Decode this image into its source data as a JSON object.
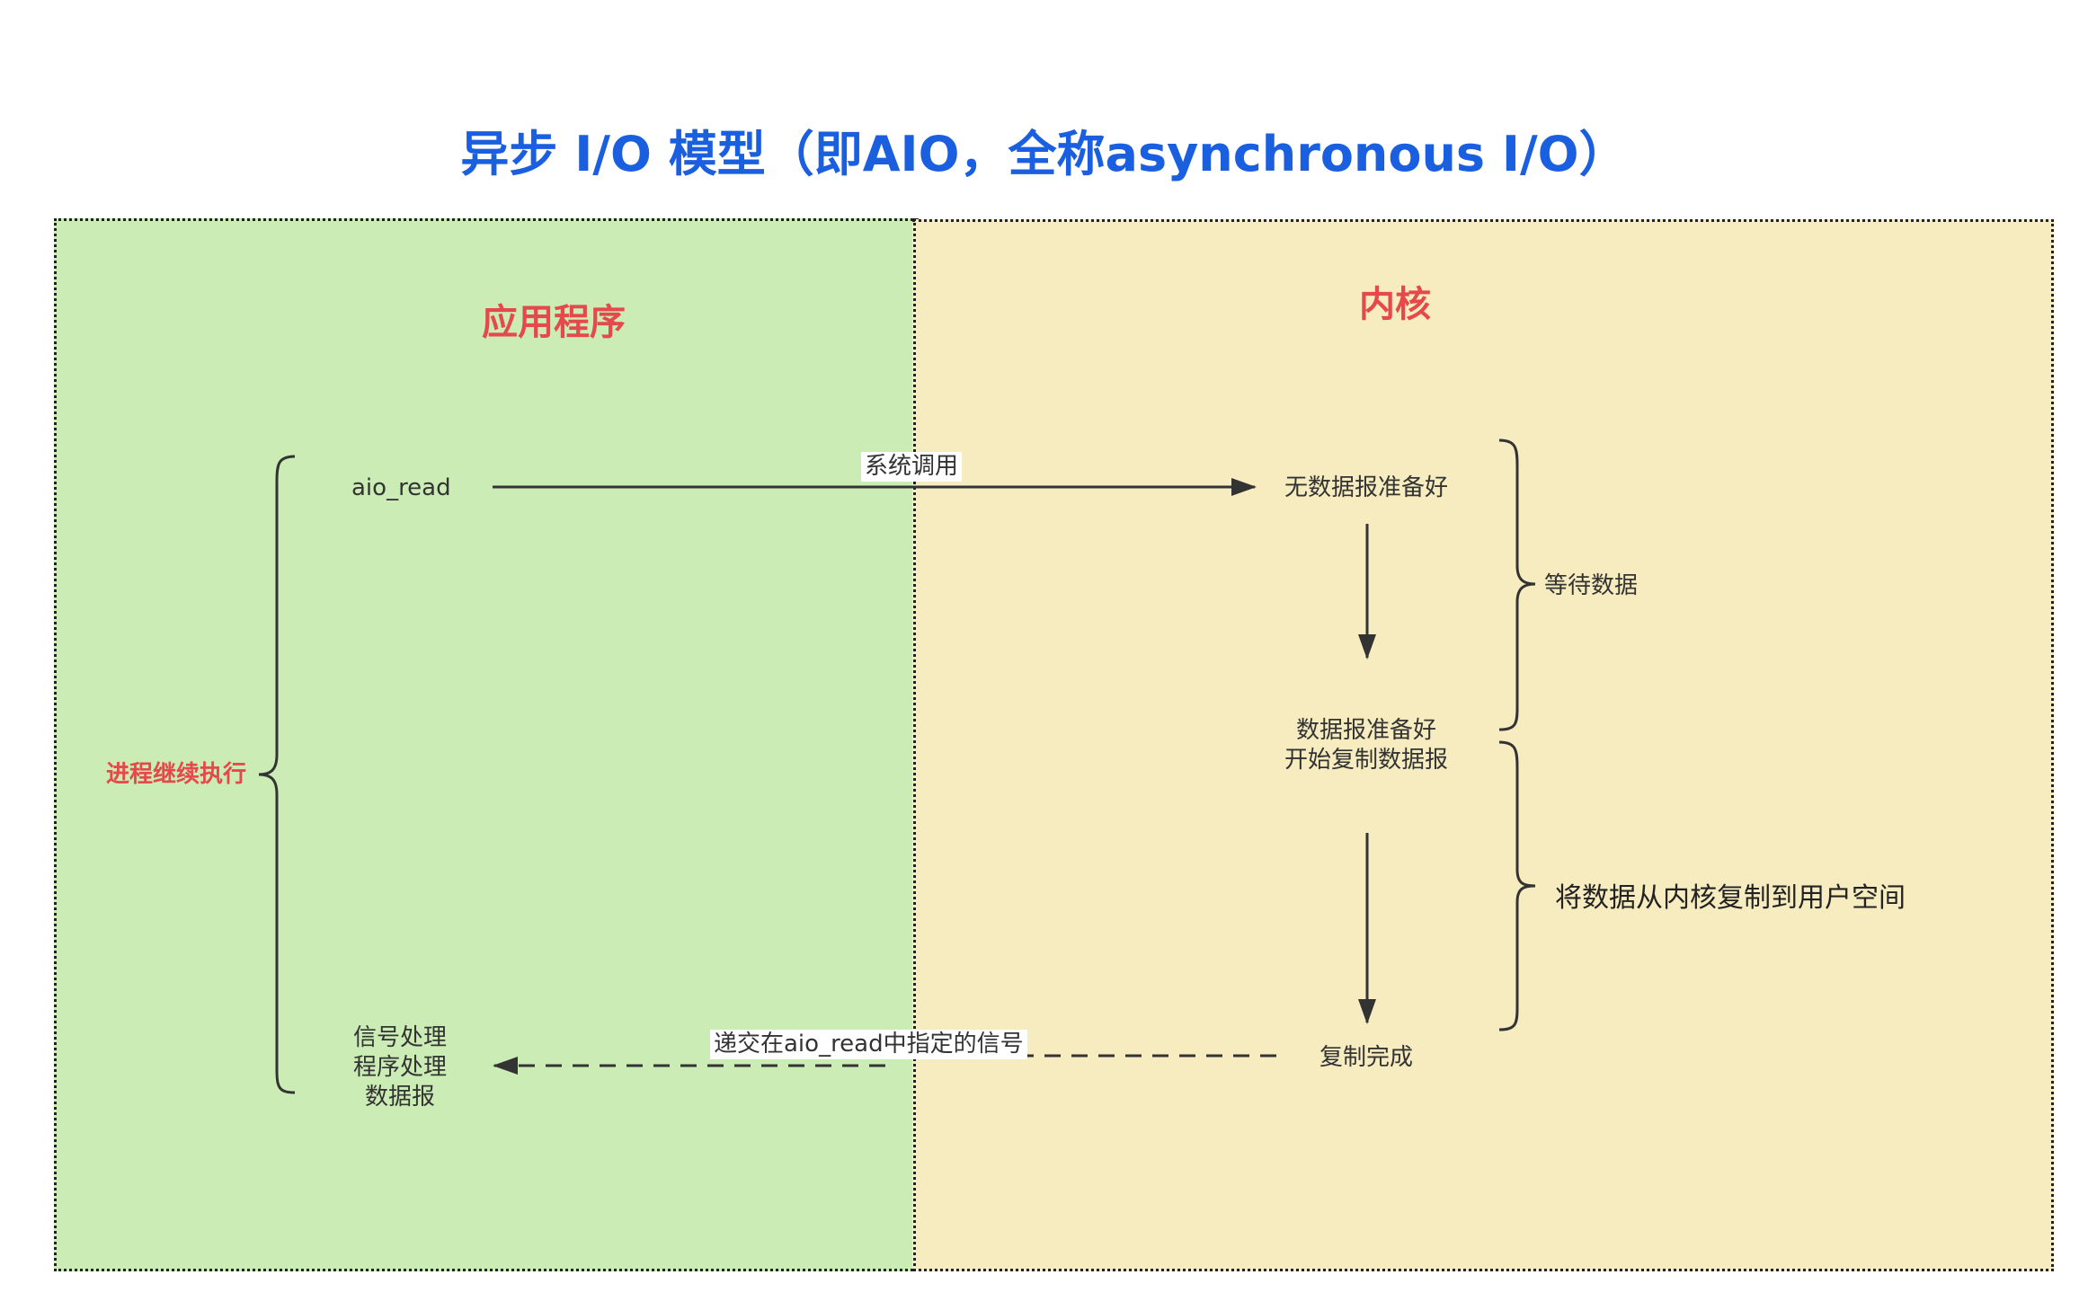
{
  "title": "异步 I/O 模型（即AIO，全称asynchronous I/O）",
  "sections": {
    "app": {
      "heading": "应用程序"
    },
    "kernel": {
      "heading": "内核"
    }
  },
  "app": {
    "call": "aio_read",
    "handler_lines": [
      "信号处理",
      "程序处理",
      "数据报"
    ],
    "brace_label": "进程继续执行"
  },
  "kernel": {
    "step1": "无数据报准备好",
    "step2_lines": [
      "数据报准备好",
      "开始复制数据报"
    ],
    "step3": "复制完成",
    "brace_wait": "等待数据",
    "brace_copy": "将数据从内核复制到用户空间"
  },
  "arrows": {
    "syscall": "系统调用",
    "signal": "递交在aio_read中指定的信号"
  },
  "colors": {
    "title": "#1a5fe0",
    "heading": "#e5484d",
    "app_bg": "#cbecb4",
    "kernel_bg": "#f6ecc0",
    "line": "#333333"
  }
}
